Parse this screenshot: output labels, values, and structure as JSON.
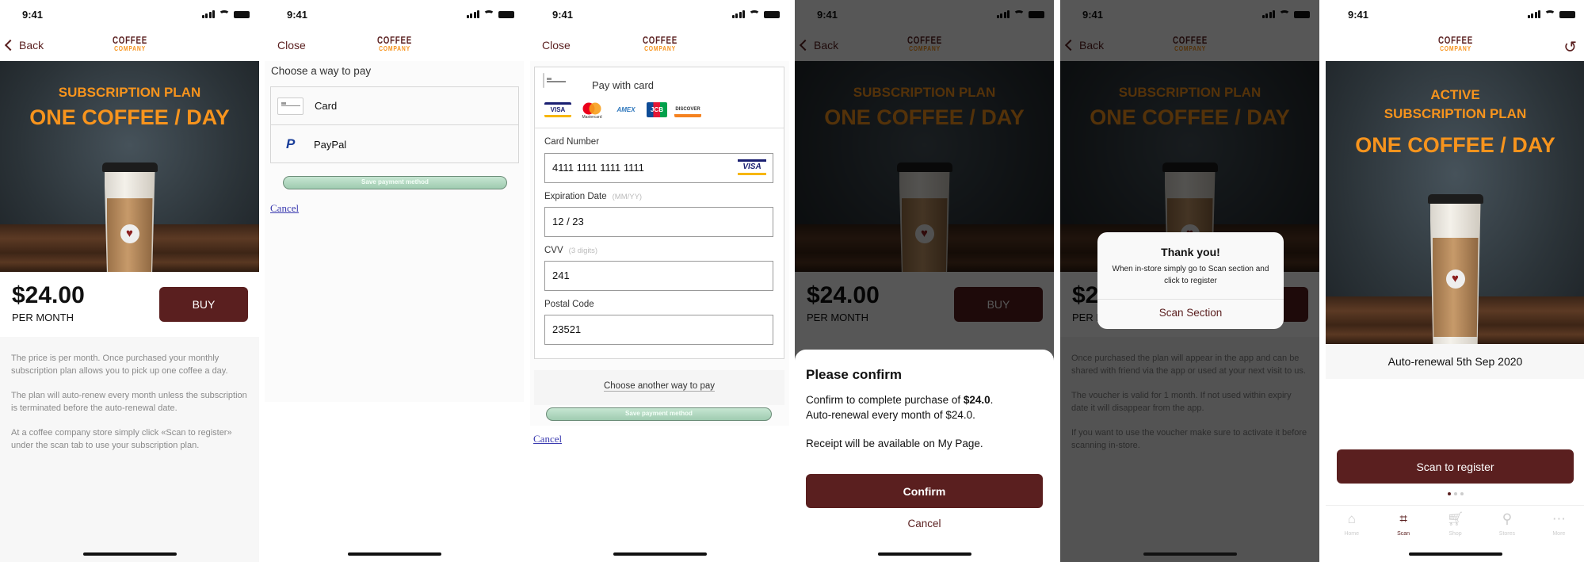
{
  "status": {
    "time": "9:41"
  },
  "brand": {
    "line1": "COFFEE",
    "line2": "COMPANY",
    "maroon": "#5a1f1f",
    "orange": "#f7941d"
  },
  "plan": {
    "eyebrow": "SUBSCRIPTION PLAN",
    "title": "ONE COFFEE / DAY",
    "price": "$24.00",
    "period": "PER MONTH",
    "buy_label": "BUY",
    "back_label": "Back",
    "description": [
      "The price is per month. Once purchased your monthly subscription plan allows you to pick up one coffee a day.",
      "The plan will auto-renew every month unless the subscription is terminated before the auto-renewal date.",
      "At a coffee company store simply click «Scan to register» under the scan tab to use your subscription plan."
    ]
  },
  "payment_choice": {
    "close_label": "Close",
    "heading": "Choose a way to pay",
    "options": [
      {
        "label": "Card",
        "icon": "credit-card-icon"
      },
      {
        "label": "PayPal",
        "icon": "paypal-icon"
      }
    ],
    "save_label": "Save payment method",
    "cancel_label": "Cancel"
  },
  "card_form": {
    "close_label": "Close",
    "heading": "Pay with card",
    "brands": [
      "VISA",
      "Mastercard",
      "AMEX",
      "JCB",
      "DISCOVER"
    ],
    "fields": {
      "card_number": {
        "label": "Card Number",
        "value": "4111 1111 1111 1111",
        "brand": "VISA"
      },
      "expiry": {
        "label": "Expiration Date",
        "hint": "(MM/YY)",
        "value": "12 / 23"
      },
      "cvv": {
        "label": "CVV",
        "hint": "(3 digits)",
        "value": "241"
      },
      "postal": {
        "label": "Postal Code",
        "value": "23521"
      }
    },
    "another_way_label": "Choose another way to pay",
    "save_label": "Save payment method",
    "cancel_label": "Cancel"
  },
  "confirm_sheet": {
    "title": "Please confirm",
    "line1_prefix": "Confirm to complete purchase of ",
    "line1_amount": "$24.0",
    "line1_suffix": ".",
    "line2": "Auto-renewal every month of $24.0.",
    "line3": "Receipt will be available on My Page.",
    "confirm_label": "Confirm",
    "cancel_label": "Cancel"
  },
  "thanks_alert": {
    "title": "Thank you!",
    "message": "When in-store simply go to Scan section and click to register",
    "action_label": "Scan Section",
    "background_description": [
      "Once purchased the plan will appear in the app and can be shared with friend via the app or used at your next visit to us.",
      "The voucher is valid for 1 month. If not used within expiry date it will disappear from the app.",
      "If you want to use the voucher make sure to activate it before scanning in-store."
    ]
  },
  "active": {
    "eyebrow1": "ACTIVE",
    "eyebrow2": "SUBSCRIPTION PLAN",
    "title": "ONE COFFEE / DAY",
    "renewal": "Auto-renewal 5th Sep 2020",
    "scan_label": "Scan to register",
    "page_dots": {
      "count": 3,
      "active": 1
    },
    "tabs": [
      {
        "label": "Home",
        "icon": "home-icon",
        "active": false
      },
      {
        "label": "Scan",
        "icon": "qr-scan-icon",
        "active": true
      },
      {
        "label": "Shop",
        "icon": "cart-icon",
        "active": false
      },
      {
        "label": "Stores",
        "icon": "map-pin-icon",
        "active": false
      },
      {
        "label": "More",
        "icon": "more-icon",
        "active": false
      }
    ]
  }
}
